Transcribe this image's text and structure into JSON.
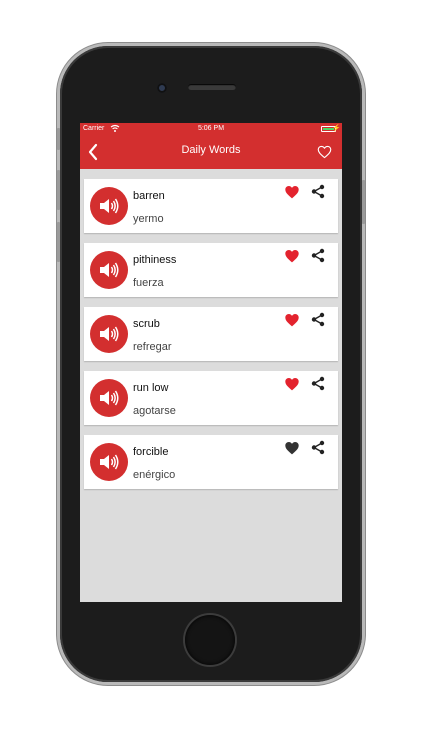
{
  "status_bar": {
    "carrier": "Carrier",
    "time": "5:06 PM"
  },
  "nav": {
    "title": "Daily Words",
    "back_icon": "chevron-left-icon",
    "favorites_icon": "heart-outline-icon"
  },
  "colors": {
    "primary_red": "#d32f2f",
    "favorite_active": "#e3232e",
    "favorite_inactive": "#333333",
    "battery_green": "#4cd964"
  },
  "words": [
    {
      "word": "barren",
      "translation": "yermo",
      "favorited": true
    },
    {
      "word": "pithiness",
      "translation": "fuerza",
      "favorited": true
    },
    {
      "word": "scrub",
      "translation": "refregar",
      "favorited": true
    },
    {
      "word": "run low",
      "translation": "agotarse",
      "favorited": true
    },
    {
      "word": "forcible",
      "translation": "enérgico",
      "favorited": false
    }
  ]
}
